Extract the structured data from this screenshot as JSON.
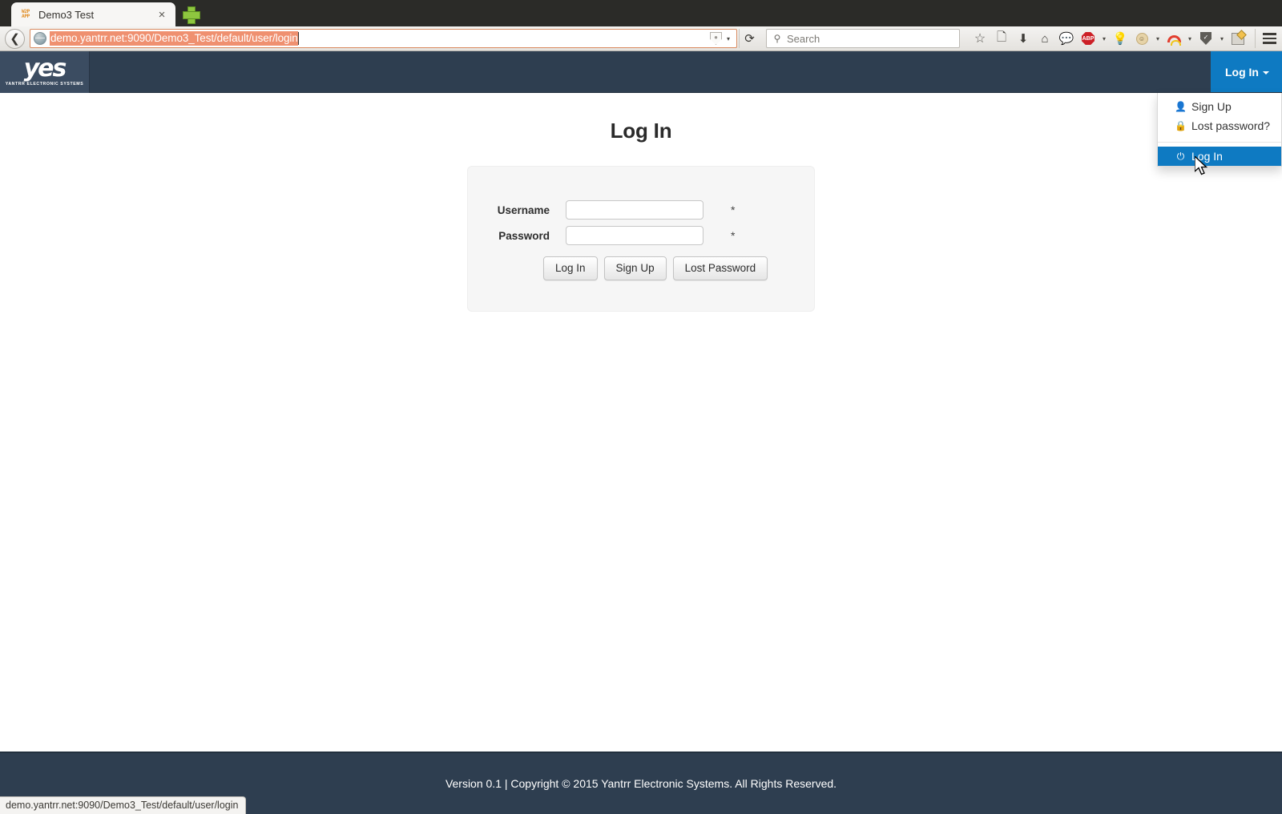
{
  "browser": {
    "tab": {
      "title": "Demo3 Test",
      "favicon_text_top": "W2P",
      "favicon_text_bottom": "APP",
      "close_label": "×"
    },
    "new_tab_label": "new-tab",
    "back_icon": "⬅",
    "url": {
      "value": "demo.yantrr.net:9090/Demo3_Test/default/user/login",
      "globe_icon": "globe-icon",
      "bookmark_shield_icon": "shield-icon",
      "dropdown_caret": "▾",
      "reload_icon": "⟳"
    },
    "search": {
      "placeholder": "Search",
      "icon": "⚲"
    },
    "toolbar_icons": [
      {
        "name": "bookmark-star-icon",
        "glyph": "☆"
      },
      {
        "name": "reader-list-icon",
        "glyph": "▤"
      },
      {
        "name": "downloads-icon",
        "glyph": "⬇"
      },
      {
        "name": "home-icon",
        "glyph": "⌂"
      },
      {
        "name": "chat-bubble-icon",
        "glyph": "☺"
      },
      {
        "name": "adblock-plus-icon",
        "glyph": "ABP"
      },
      {
        "name": "lightbulb-icon",
        "glyph": "Ὂ1"
      },
      {
        "name": "monkey-face-icon",
        "glyph": "๏"
      },
      {
        "name": "rainbow-icon",
        "glyph": "rainbow"
      },
      {
        "name": "shield-icon",
        "glyph": "shield"
      },
      {
        "name": "notepad-icon",
        "glyph": "notepad"
      }
    ],
    "menu_icon": "hamburger-icon",
    "statusbar_url": "demo.yantrr.net:9090/Demo3_Test/default/user/login"
  },
  "site": {
    "brand": {
      "mark": "yes",
      "subtitle": "YANTRR  ELECTRONIC  SYSTEMS"
    },
    "navbar": {
      "login_label": "Log In",
      "bg_color": "#2e3e50",
      "active_color": "#0e7ac2"
    },
    "dropdown": {
      "items": [
        {
          "label": "Sign Up",
          "icon": "user-icon",
          "glyph": "👤",
          "active": false
        },
        {
          "label": "Lost password?",
          "icon": "lock-icon",
          "glyph": "🔒",
          "active": false
        },
        {
          "label": "Log In",
          "icon": "power-icon",
          "glyph": "⏻",
          "active": true
        }
      ]
    },
    "main": {
      "title": "Log In",
      "fields": [
        {
          "label": "Username",
          "value": "",
          "placeholder": "",
          "required_mark": "*",
          "type": "text"
        },
        {
          "label": "Password",
          "value": "",
          "placeholder": "",
          "required_mark": "*",
          "type": "password"
        }
      ],
      "buttons": [
        {
          "label": "Log In",
          "name": "login-button"
        },
        {
          "label": "Sign Up",
          "name": "signup-button"
        },
        {
          "label": "Lost Password",
          "name": "lost-password-button"
        }
      ]
    },
    "footer": {
      "text": "Version 0.1 | Copyright © 2015 Yantrr Electronic Systems. All Rights Reserved."
    }
  }
}
